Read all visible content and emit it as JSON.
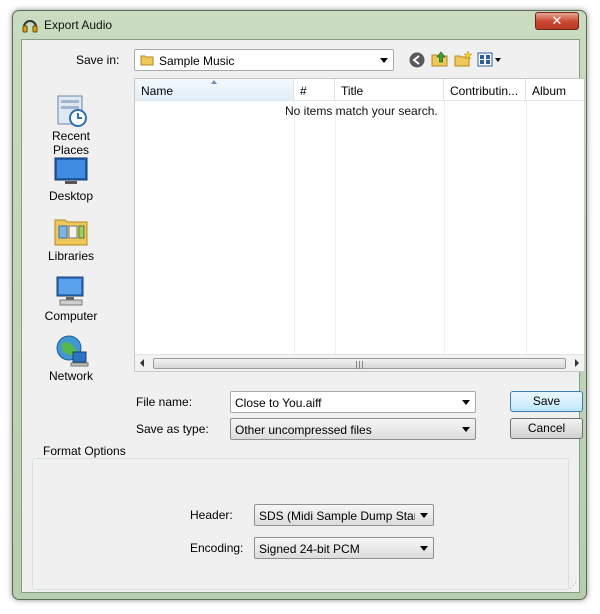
{
  "window": {
    "title": "Export Audio",
    "close_label": "✕"
  },
  "toolbar": {
    "save_in_label": "Save in:",
    "location": "Sample Music",
    "icons": [
      "back-icon",
      "up-folder-icon",
      "new-folder-icon",
      "view-menu-icon"
    ]
  },
  "places": [
    {
      "label": "Recent Places",
      "icon": "recent-places-icon"
    },
    {
      "label": "Desktop",
      "icon": "desktop-icon"
    },
    {
      "label": "Libraries",
      "icon": "libraries-icon"
    },
    {
      "label": "Computer",
      "icon": "computer-icon"
    },
    {
      "label": "Network",
      "icon": "network-icon"
    }
  ],
  "filelist": {
    "columns": [
      "Name",
      "#",
      "Title",
      "Contributin...",
      "Album"
    ],
    "empty_message": "No items match your search."
  },
  "form": {
    "file_name_label": "File name:",
    "file_name_value": "Close to You.aiff",
    "save_as_type_label": "Save as type:",
    "save_as_type_value": "Other uncompressed files",
    "save_button": "Save",
    "cancel_button": "Cancel"
  },
  "format_options": {
    "title": "Format Options",
    "header_label": "Header:",
    "header_value": "SDS (Midi Sample Dump Stan",
    "encoding_label": "Encoding:",
    "encoding_value": "Signed 24-bit PCM"
  },
  "colors": {
    "accent": "#3c7fb1",
    "close": "#c9462f"
  }
}
